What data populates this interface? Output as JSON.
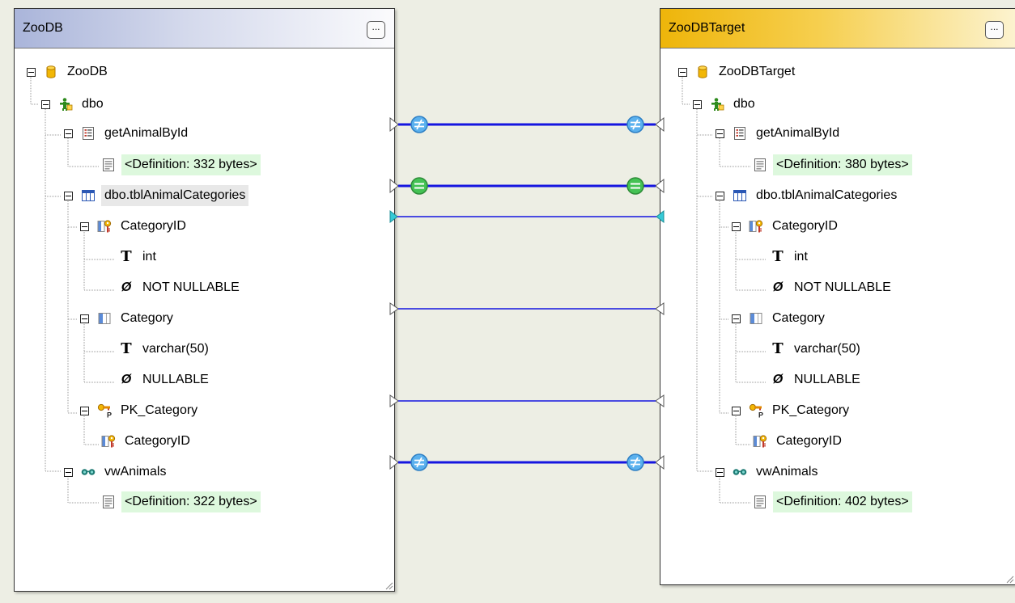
{
  "source_panel": {
    "title": "ZooDB",
    "menu_label": "...",
    "tree": {
      "root": "ZooDB",
      "schema": "dbo",
      "proc_name": "getAnimalById",
      "proc_def": "<Definition: 332 bytes>",
      "table_name": "dbo.tblAnimalCategories",
      "col1_name": "CategoryID",
      "col1_type": "int",
      "col1_null": "NOT NULLABLE",
      "col2_name": "Category",
      "col2_type": "varchar(50)",
      "col2_null": "NULLABLE",
      "pk_name": "PK_Category",
      "pk_col": "CategoryID",
      "view_name": "vwAnimals",
      "view_def": "<Definition: 322 bytes>"
    }
  },
  "target_panel": {
    "title": "ZooDBTarget",
    "menu_label": "...",
    "tree": {
      "root": "ZooDBTarget",
      "schema": "dbo",
      "proc_name": "getAnimalById",
      "proc_def": "<Definition: 380 bytes>",
      "table_name": "dbo.tblAnimalCategories",
      "col1_name": "CategoryID",
      "col1_type": "int",
      "col1_null": "NOT NULLABLE",
      "col2_name": "Category",
      "col2_type": "varchar(50)",
      "col2_null": "NULLABLE",
      "pk_name": "PK_Category",
      "pk_col": "CategoryID",
      "view_name": "vwAnimals",
      "view_def": "<Definition: 402 bytes>"
    }
  },
  "mappings": [
    {
      "item": "getAnimalById",
      "status": "different",
      "status_icon": "not-equal-icon"
    },
    {
      "item": "dbo.tblAnimalCategories",
      "status": "equal",
      "status_icon": "equal-icon"
    },
    {
      "item": "CategoryID",
      "status": "selected"
    },
    {
      "item": "Category",
      "status": "mapped"
    },
    {
      "item": "PK_Category",
      "status": "mapped"
    },
    {
      "item": "vwAnimals",
      "status": "different",
      "status_icon": "not-equal-icon"
    }
  ],
  "colors": {
    "mapping_line": "#1515e0",
    "different_badge": "#5bb1ee",
    "equal_badge": "#44c254",
    "selected_marker": "#35c9d6",
    "definition_highlight": "#ddf8dd",
    "source_header": "#aab5da",
    "target_header": "#eeb50a"
  }
}
